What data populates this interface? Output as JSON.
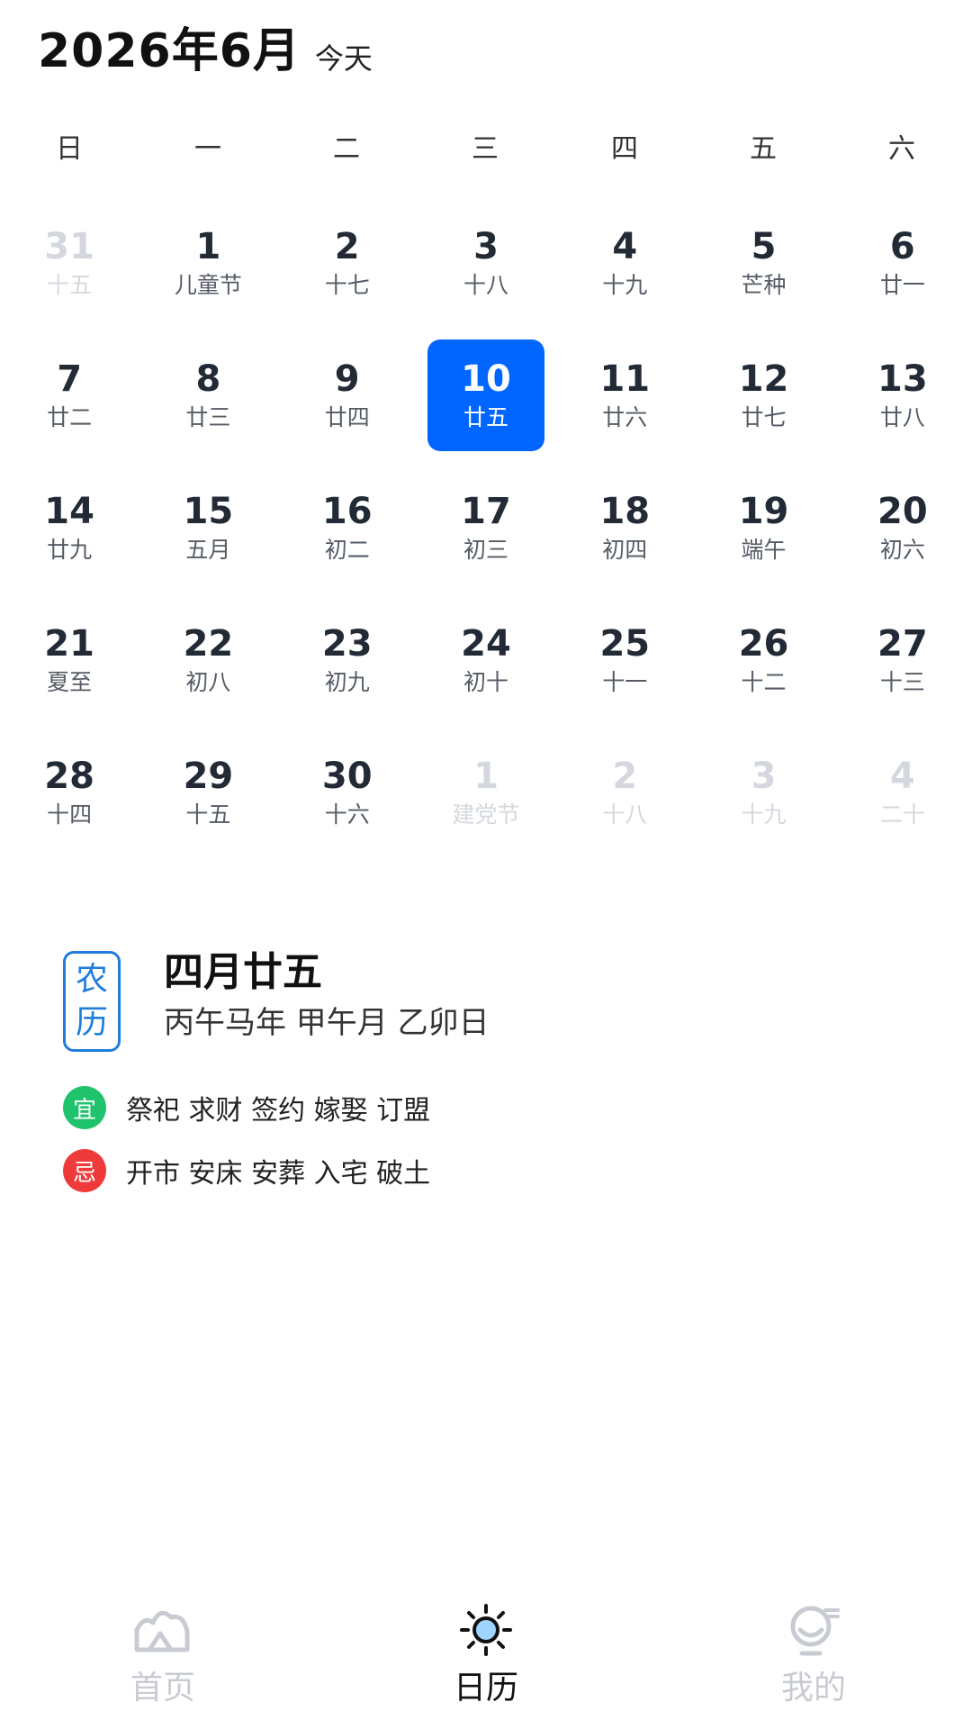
{
  "header": {
    "title": "2026年6月",
    "today": "今天"
  },
  "weekdays": [
    "日",
    "一",
    "二",
    "三",
    "四",
    "五",
    "六"
  ],
  "days": [
    {
      "num": "31",
      "lunar": "十五",
      "other": true
    },
    {
      "num": "1",
      "lunar": "儿童节"
    },
    {
      "num": "2",
      "lunar": "十七"
    },
    {
      "num": "3",
      "lunar": "十八"
    },
    {
      "num": "4",
      "lunar": "十九"
    },
    {
      "num": "5",
      "lunar": "芒种"
    },
    {
      "num": "6",
      "lunar": "廿一"
    },
    {
      "num": "7",
      "lunar": "廿二"
    },
    {
      "num": "8",
      "lunar": "廿三"
    },
    {
      "num": "9",
      "lunar": "廿四"
    },
    {
      "num": "10",
      "lunar": "廿五",
      "selected": true
    },
    {
      "num": "11",
      "lunar": "廿六"
    },
    {
      "num": "12",
      "lunar": "廿七"
    },
    {
      "num": "13",
      "lunar": "廿八"
    },
    {
      "num": "14",
      "lunar": "廿九"
    },
    {
      "num": "15",
      "lunar": "五月"
    },
    {
      "num": "16",
      "lunar": "初二"
    },
    {
      "num": "17",
      "lunar": "初三"
    },
    {
      "num": "18",
      "lunar": "初四"
    },
    {
      "num": "19",
      "lunar": "端午"
    },
    {
      "num": "20",
      "lunar": "初六"
    },
    {
      "num": "21",
      "lunar": "夏至"
    },
    {
      "num": "22",
      "lunar": "初八"
    },
    {
      "num": "23",
      "lunar": "初九"
    },
    {
      "num": "24",
      "lunar": "初十"
    },
    {
      "num": "25",
      "lunar": "十一"
    },
    {
      "num": "26",
      "lunar": "十二"
    },
    {
      "num": "27",
      "lunar": "十三"
    },
    {
      "num": "28",
      "lunar": "十四"
    },
    {
      "num": "29",
      "lunar": "十五"
    },
    {
      "num": "30",
      "lunar": "十六"
    },
    {
      "num": "1",
      "lunar": "建党节",
      "other": true
    },
    {
      "num": "2",
      "lunar": "十八",
      "other": true
    },
    {
      "num": "3",
      "lunar": "十九",
      "other": true
    },
    {
      "num": "4",
      "lunar": "二十",
      "other": true
    }
  ],
  "lunar_info": {
    "badge_chars": [
      "农",
      "历"
    ],
    "date": "四月廿五",
    "ganzhi": "丙午马年 甲午月 乙卯日"
  },
  "yi": {
    "badge": "宜",
    "items": "祭祀 求财 签约 嫁娶 订盟",
    "color": "#1ec36c"
  },
  "ji": {
    "badge": "忌",
    "items": "开市 安床 安葬 入宅 破土",
    "color": "#ee3a3a"
  },
  "tabs": [
    {
      "label": "首页",
      "icon": "mountain-icon",
      "active": false
    },
    {
      "label": "日历",
      "icon": "sun-icon",
      "active": true
    },
    {
      "label": "我的",
      "icon": "profile-icon",
      "active": false
    }
  ],
  "colors": {
    "accent": "#0066ff",
    "lunar_badge": "#1f7ddd",
    "inactive_tab": "#c8ccd2"
  }
}
